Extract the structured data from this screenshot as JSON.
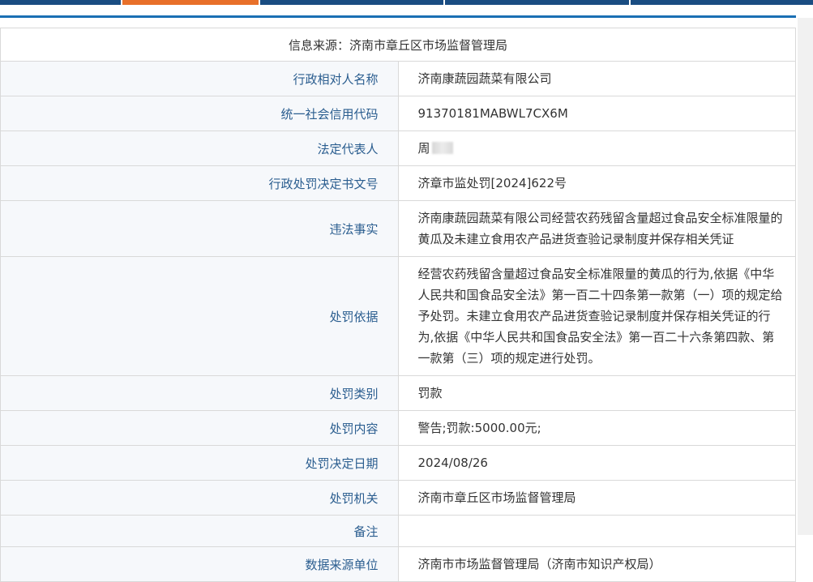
{
  "source_line": "信息来源：济南市章丘区市场监督管理局",
  "rows": [
    {
      "label": "行政相对人名称",
      "value": "济南康蔬园蔬菜有限公司"
    },
    {
      "label": "统一社会信用代码",
      "value": "91370181MABWL7CX6M"
    },
    {
      "label": "法定代表人",
      "value": "周"
    },
    {
      "label": "行政处罚决定书文号",
      "value": "济章市监处罚[2024]622号"
    },
    {
      "label": "违法事实",
      "value": "济南康蔬园蔬菜有限公司经营农药残留含量超过食品安全标准限量的黄瓜及未建立食用农产品进货查验记录制度并保存相关凭证"
    },
    {
      "label": "处罚依据",
      "value": "经营农药残留含量超过食品安全标准限量的黄瓜的行为,依据《中华人民共和国食品安全法》第一百二十四条第一款第（一）项的规定给予处罚。未建立食用农产品进货查验记录制度并保存相关凭证的行为,依据《中华人民共和国食品安全法》第一百二十六条第四款、第一款第（三）项的规定进行处罚。"
    },
    {
      "label": "处罚类别",
      "value": "罚款"
    },
    {
      "label": "处罚内容",
      "value": "警告;罚款:5000.00元;"
    },
    {
      "label": "处罚决定日期",
      "value": "2024/08/26"
    },
    {
      "label": "处罚机关",
      "value": "济南市章丘区市场监督管理局"
    },
    {
      "label": "备注",
      "value": ""
    },
    {
      "label": "数据来源单位",
      "value": "济南市市场监督管理局（济南市知识产权局）"
    }
  ],
  "colors": {
    "header_bar": "#1a4d82",
    "header_accent": "#e8702a",
    "rule": "#1a6fb3",
    "label_text": "#2a5d8f"
  }
}
